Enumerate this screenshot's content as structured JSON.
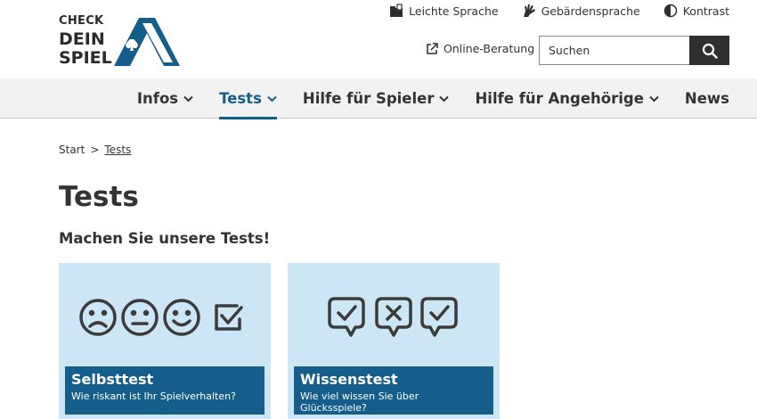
{
  "logo": {
    "line1": "CHECK",
    "line2": "DEIN",
    "line3": "SPIEL"
  },
  "utility_nav": [
    {
      "label": "Leichte Sprache",
      "icon": "book-icon"
    },
    {
      "label": "Gebärdensprache",
      "icon": "sign-language-icon"
    },
    {
      "label": "Kontrast",
      "icon": "contrast-icon"
    }
  ],
  "online_beratung": {
    "label": "Online-Beratung",
    "icon": "external-link-icon"
  },
  "search": {
    "placeholder": "Suchen",
    "icon": "search-icon"
  },
  "main_nav": [
    {
      "label": "Infos",
      "active": false
    },
    {
      "label": "Tests",
      "active": true
    },
    {
      "label": "Hilfe für Spieler",
      "active": false
    },
    {
      "label": "Hilfe für Angehörige",
      "active": false
    },
    {
      "label": "News",
      "active": false
    }
  ],
  "breadcrumb": {
    "home": "Start",
    "separator": ">",
    "current": "Tests"
  },
  "page": {
    "title": "Tests",
    "subtitle": "Machen Sie unsere Tests!"
  },
  "cards": [
    {
      "title": "Selbsttest",
      "subtitle": "Wie riskant ist Ihr Spielverhalten?",
      "icons": [
        "sad-face-icon",
        "neutral-face-icon",
        "happy-face-icon",
        "checkbox-icon"
      ]
    },
    {
      "title": "Wissenstest",
      "subtitle": "Wie viel wissen Sie über Glücksspiele?",
      "icons": [
        "speech-check-icon",
        "speech-cross-icon",
        "speech-check-icon"
      ]
    }
  ],
  "colors": {
    "brand_blue": "#155d8a",
    "card_bg": "#cde6f5",
    "nav_bg": "#f2f2f2",
    "text": "#333333"
  }
}
